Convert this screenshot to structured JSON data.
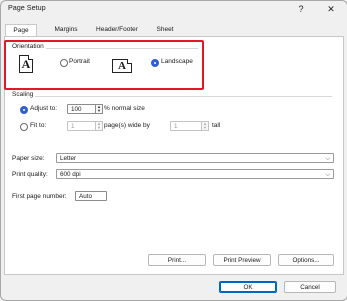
{
  "window": {
    "title": "Page Setup",
    "help_label": "?",
    "close_label": "✕"
  },
  "tabs": [
    {
      "label": "Page"
    },
    {
      "label": "Margins"
    },
    {
      "label": "Header/Footer"
    },
    {
      "label": "Sheet"
    }
  ],
  "orientation": {
    "group_label": "Orientation",
    "portrait_label": "Portrait",
    "landscape_label": "Landscape",
    "icon_letter": "A",
    "selected": "Landscape"
  },
  "scaling": {
    "group_label": "Scaling",
    "adjust_label": "Adjust to:",
    "adjust_value": "100",
    "adjust_suffix": "% normal size",
    "fit_label": "Fit to:",
    "fit_wide_value": "1",
    "fit_wide_suffix": "page(s) wide by",
    "fit_tall_value": "1",
    "fit_tall_suffix": "tall",
    "selected": "Adjust to"
  },
  "paper_size": {
    "label": "Paper size:",
    "value": "Letter"
  },
  "print_quality": {
    "label": "Print quality:",
    "value": "600 dpi"
  },
  "first_page": {
    "label": "First page number:",
    "value": "Auto"
  },
  "buttons": {
    "print": "Print...",
    "preview": "Print Preview",
    "options": "Options...",
    "ok": "OK",
    "cancel": "Cancel"
  },
  "colors": {
    "highlight": "#e0182d",
    "accent": "#2f5fd0"
  }
}
